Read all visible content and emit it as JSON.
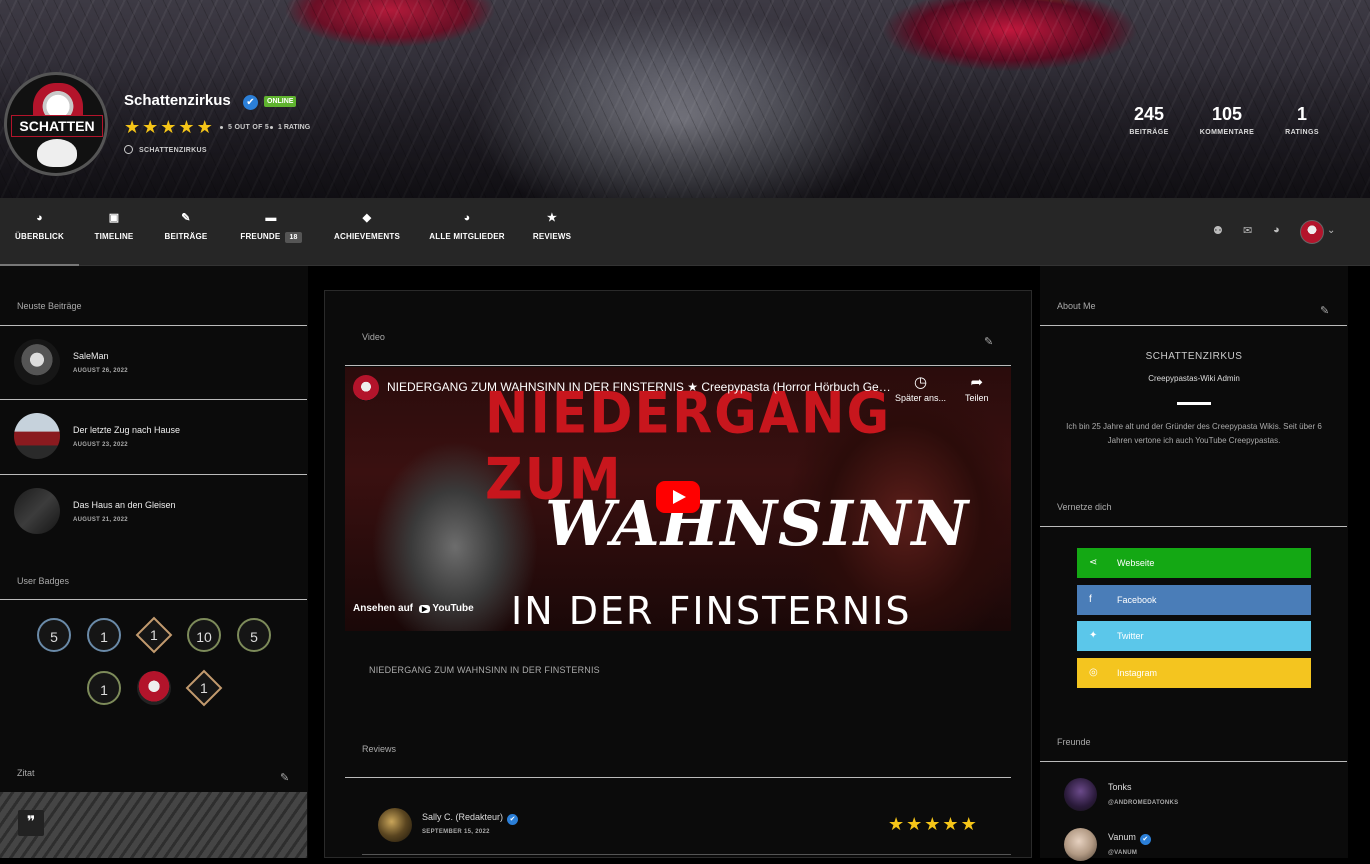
{
  "profile": {
    "name": "Schattenzirkus",
    "status": "ONLINE",
    "avatar_text": "SCHATTEN",
    "rating_text": "5 OUT OF 5",
    "rating_count": "1 RATING",
    "rating": 5,
    "handle": "SCHATTENZIRKUS"
  },
  "stats": [
    {
      "value": "245",
      "label": "BEITRÄGE"
    },
    {
      "value": "105",
      "label": "KOMMENTARE"
    },
    {
      "value": "1",
      "label": "RATINGS"
    }
  ],
  "nav": [
    {
      "label": "ÜBERBLICK",
      "icon": "globe-icon",
      "glyph": "◕"
    },
    {
      "label": "TIMELINE",
      "icon": "id-card-icon",
      "glyph": "▣"
    },
    {
      "label": "BEITRÄGE",
      "icon": "pencil-icon",
      "glyph": "✎"
    },
    {
      "label": "FREUNDE",
      "icon": "handshake-icon",
      "glyph": "▬",
      "count": "18"
    },
    {
      "label": "ACHIEVEMENTS",
      "icon": "diamond-icon",
      "glyph": "◆"
    },
    {
      "label": "ALLE MITGLIEDER",
      "icon": "globe-icon",
      "glyph": "◕"
    },
    {
      "label": "REVIEWS",
      "icon": "star-icon",
      "glyph": "★"
    }
  ],
  "left": {
    "posts_title": "Neuste Beiträge",
    "posts": [
      {
        "title": "SaleMan",
        "date": "AUGUST 26, 2022"
      },
      {
        "title": "Der letzte Zug nach Hause",
        "date": "AUGUST 23, 2022"
      },
      {
        "title": "Das Haus an den Gleisen",
        "date": "AUGUST 21, 2022"
      }
    ],
    "badges_title": "User Badges",
    "badges": [
      "5",
      "1",
      "1",
      "10",
      "5",
      "1",
      "",
      "1"
    ],
    "quote_title": "Zitat"
  },
  "main": {
    "video_title": "Video",
    "video_heading": "NIEDERGANG ZUM WAHNSINN IN DER FINSTERNIS ★ Creepypasta (Horror Hörbuch German...",
    "thumb_line1": "NIEDERGANG ZUM",
    "thumb_line2": "WAHNSINN",
    "thumb_line3": "IN DER FINSTERNIS",
    "watch_later": "Später ans...",
    "share": "Teilen",
    "watch_on": "Ansehen auf",
    "youtube": "YouTube",
    "caption": "NIEDERGANG ZUM WAHNSINN IN DER FINSTERNIS",
    "reviews_title": "Reviews",
    "review": {
      "name": "Sally C. (Redakteur)",
      "date": "SEPTEMBER 15, 2022",
      "stars": 5
    }
  },
  "right": {
    "about_title": "About Me",
    "about_name": "SCHATTENZIRKUS",
    "about_role": "Creepypastas-Wiki Admin",
    "about_text": "Ich bin 25 Jahre alt und der Gründer des Creepypasta Wikis. Seit über 6 Jahren vertone ich auch YouTube Creepypastas.",
    "social_title": "Vernetze dich",
    "social": [
      {
        "label": "Webseite",
        "color": "#14a814",
        "icon": "share-icon",
        "glyph": "⋖"
      },
      {
        "label": "Facebook",
        "color": "#4a7db8",
        "icon": "facebook-icon",
        "glyph": "f"
      },
      {
        "label": "Twitter",
        "color": "#5bc7ea",
        "icon": "twitter-icon",
        "glyph": "✦"
      },
      {
        "label": "Instagram",
        "color": "#f4c51f",
        "icon": "instagram-icon",
        "glyph": "◎"
      }
    ],
    "friends_title": "Freunde",
    "friends": [
      {
        "name": "Tonks",
        "handle": "@ANDROMEDATONKS"
      },
      {
        "name": "Vanum",
        "handle": "@VANUM"
      }
    ]
  },
  "colors": {
    "accent": "#2b7fd8",
    "star": "#f5c518",
    "online": "#5fb32f",
    "nav_bg": "#262626"
  }
}
